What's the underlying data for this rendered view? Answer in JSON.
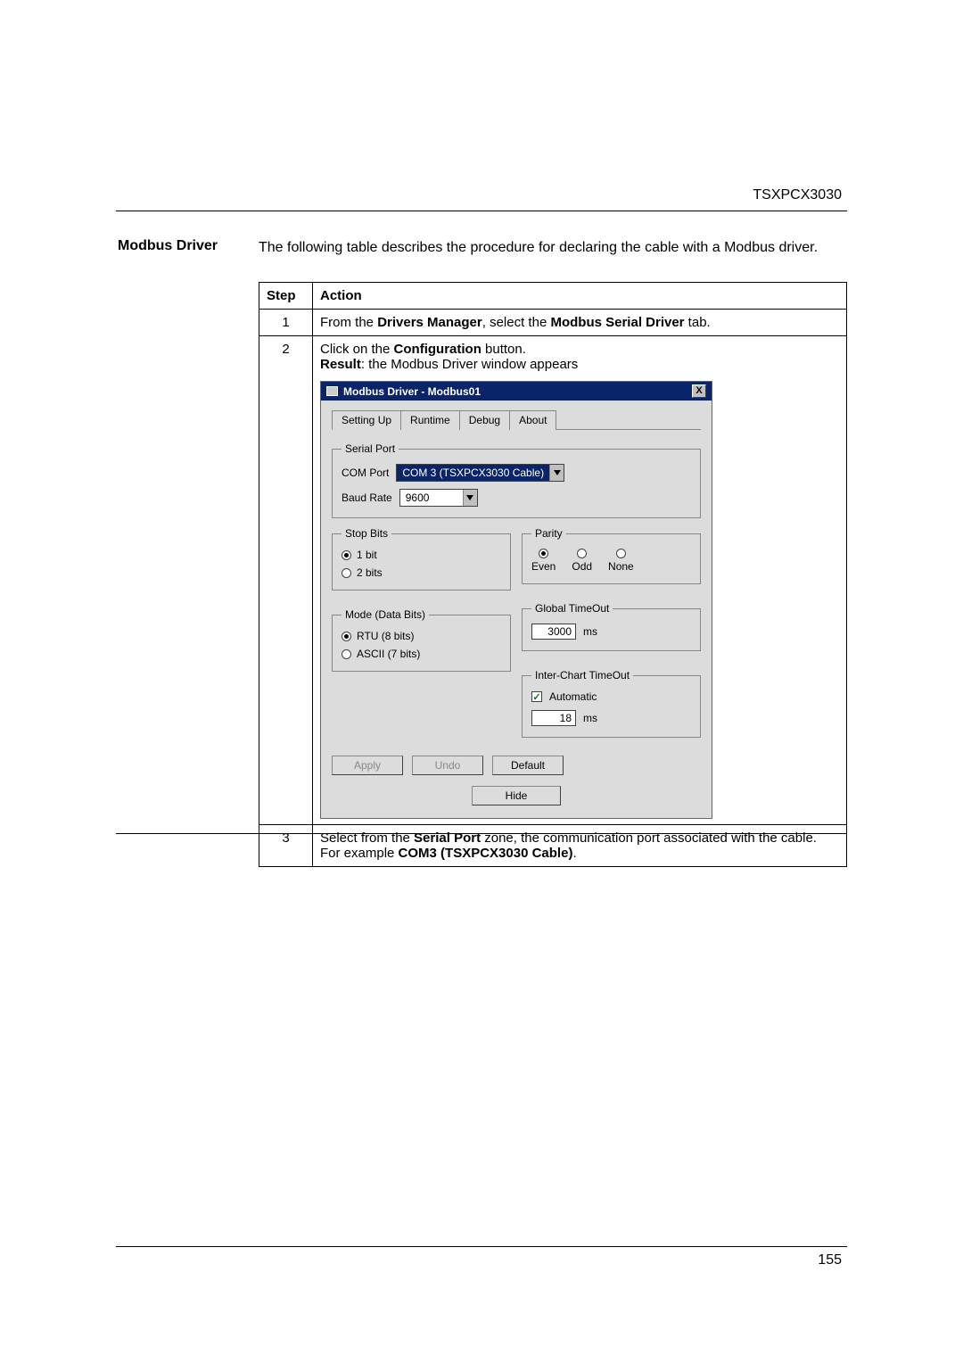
{
  "header": {
    "product": "TSXPCX3030"
  },
  "sideHeading": "Modbus Driver",
  "intro": "The following table describes the procedure for declaring the cable with a Modbus driver.",
  "table": {
    "headers": {
      "step": "Step",
      "action": "Action"
    },
    "step1": {
      "num": "1",
      "prefix": "From the ",
      "b1": "Drivers Manager",
      "mid": ", select the ",
      "b2": "Modbus Serial Driver",
      "suffix": " tab."
    },
    "step2": {
      "num": "2",
      "prefix": "Click on the ",
      "b1": "Configuration",
      "suffix": " button.",
      "resultLabel": "Result",
      "resultText": ": the Modbus Driver window appears"
    },
    "step3": {
      "num": "3",
      "prefix": "Select from the ",
      "b1": "Serial Port",
      "mid": " zone, the communication port associated with the cable. For example ",
      "b2": "COM3 (TSXPCX3030 Cable)",
      "suffix": "."
    }
  },
  "dialog": {
    "title": "Modbus Driver - Modbus01",
    "close": "X",
    "tabs": {
      "t0": "Setting Up",
      "t1": "Runtime",
      "t2": "Debug",
      "t3": "About"
    },
    "serialPort": {
      "legend": "Serial Port",
      "comLabel": "COM Port",
      "comValue": "COM 3 (TSXPCX3030 Cable)",
      "baudLabel": "Baud Rate",
      "baudValue": "9600"
    },
    "stopBits": {
      "legend": "Stop Bits",
      "opt1": "1 bit",
      "opt2": "2 bits"
    },
    "mode": {
      "legend": "Mode (Data Bits)",
      "opt1": "RTU (8 bits)",
      "opt2": "ASCII (7 bits)"
    },
    "parity": {
      "legend": "Parity",
      "even": "Even",
      "odd": "Odd",
      "none": "None"
    },
    "globalTimeout": {
      "legend": "Global TimeOut",
      "value": "3000",
      "unit": "ms"
    },
    "interChart": {
      "legend": "Inter-Chart TimeOut",
      "auto": "Automatic",
      "value": "18",
      "unit": "ms"
    },
    "buttons": {
      "apply": "Apply",
      "undo": "Undo",
      "def": "Default",
      "hide": "Hide"
    }
  },
  "pageNumber": "155"
}
